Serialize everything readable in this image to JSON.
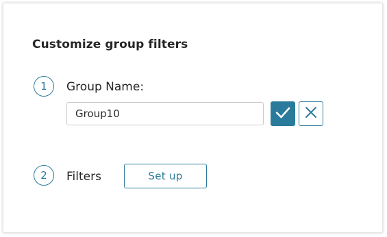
{
  "dialog": {
    "title": "Customize group filters"
  },
  "step1": {
    "number": "1",
    "label": "Group Name:",
    "input_value": "Group10",
    "confirm_icon": "check-icon",
    "cancel_icon": "close-icon"
  },
  "step2": {
    "number": "2",
    "label": "Filters",
    "setup_label": "Set up"
  },
  "colors": {
    "accent": "#2a7b9b",
    "text": "#262626",
    "border": "#c9c9c9"
  }
}
